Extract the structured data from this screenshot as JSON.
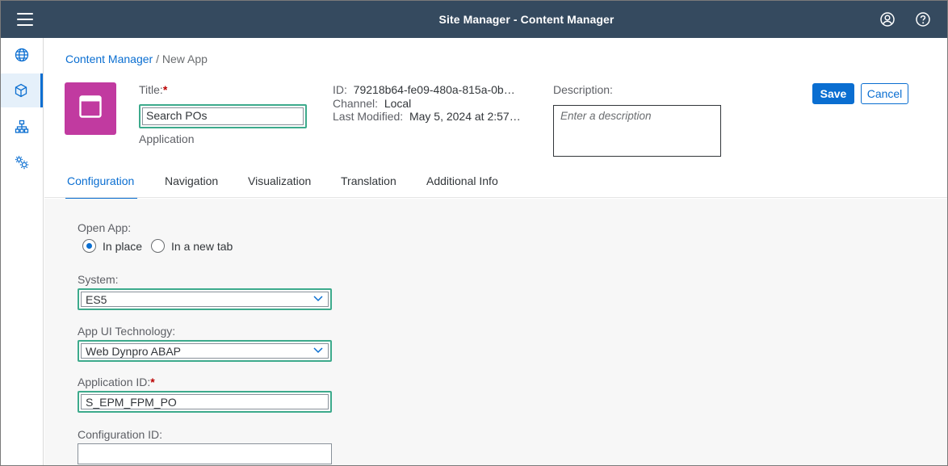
{
  "topbar": {
    "title": "Site Manager - Content Manager",
    "menu_icon": "menu-icon",
    "user_icon": "user-profile-icon",
    "help_icon": "help-icon"
  },
  "leftnav": {
    "items": [
      {
        "icon": "globe-icon",
        "active": false
      },
      {
        "icon": "content-cube-icon",
        "active": true
      },
      {
        "icon": "sitemap-icon",
        "active": false
      },
      {
        "icon": "settings-gears-icon",
        "active": false
      }
    ]
  },
  "breadcrumb": {
    "link": "Content Manager",
    "separator": "/",
    "current": "New App"
  },
  "header": {
    "title_label": "Title:",
    "required_mark": "*",
    "title_value": "Search POs",
    "app_type": "Application",
    "id_label": "ID:",
    "id_value": "79218b64-fe09-480a-815a-0b…",
    "channel_label": "Channel:",
    "channel_value": "Local",
    "last_modified_label": "Last Modified:",
    "last_modified_value": "May 5, 2024 at 2:57…",
    "description_label": "Description:",
    "description_placeholder": "Enter a description",
    "save_label": "Save",
    "cancel_label": "Cancel",
    "tile_color": "#c13aa0"
  },
  "tabs": [
    {
      "label": "Configuration",
      "active": true
    },
    {
      "label": "Navigation",
      "active": false
    },
    {
      "label": "Visualization",
      "active": false
    },
    {
      "label": "Translation",
      "active": false
    },
    {
      "label": "Additional Info",
      "active": false
    }
  ],
  "form": {
    "open_app_label": "Open App:",
    "open_app_options": [
      {
        "label": "In place",
        "selected": true
      },
      {
        "label": "In a new tab",
        "selected": false
      }
    ],
    "system_label": "System:",
    "system_value": "ES5",
    "ui_tech_label": "App UI Technology:",
    "ui_tech_value": "Web Dynpro ABAP",
    "app_id_label": "Application ID:",
    "app_id_value": "S_EPM_FPM_PO",
    "config_id_label": "Configuration ID:",
    "config_id_value": ""
  },
  "colors": {
    "shell": "#354a5f",
    "accent": "#0a6ed1",
    "highlight": "#3daa8c",
    "required": "#bb0000"
  }
}
